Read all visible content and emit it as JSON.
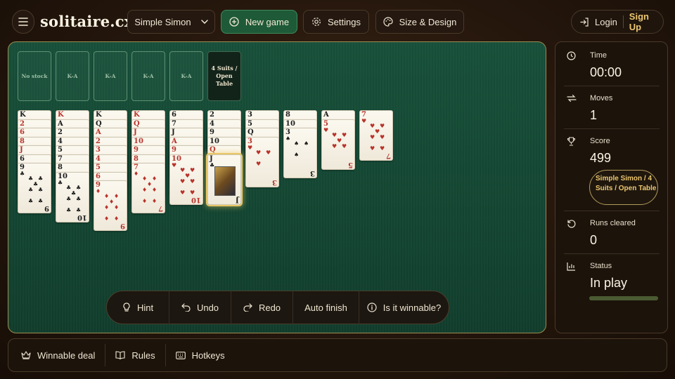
{
  "header": {
    "logo": "solitaire.cx",
    "game_select": "Simple Simon",
    "new_game": "New game",
    "settings": "Settings",
    "size_design": "Size & Design",
    "login": "Login",
    "signup": "Sign Up"
  },
  "board": {
    "stock_label": "No stock",
    "foundations": [
      "K-A",
      "K-A",
      "K-A",
      "K-A"
    ],
    "mode_badge_lines": [
      "4 Suits /",
      "Open",
      "Table"
    ]
  },
  "toolbar": {
    "hint": "Hint",
    "undo": "Undo",
    "redo": "Redo",
    "auto_finish": "Auto finish",
    "winnable": "Is it winnable?"
  },
  "sidebar": {
    "time_label": "Time",
    "time_value": "00:00",
    "moves_label": "Moves",
    "moves_value": "1",
    "score_label": "Score",
    "score_value": "499",
    "mode_badge": "Simple Simon / 4 Suits / Open Table",
    "runs_label": "Runs cleared",
    "runs_value": "0",
    "status_label": "Status",
    "status_value": "In play",
    "progress": 1.0
  },
  "footer": {
    "winnable_deal": "Winnable deal",
    "rules": "Rules",
    "hotkeys": "Hotkeys"
  },
  "colors": {
    "felt": "#134532",
    "accent": "#ecc670",
    "primary": "#1e5a37"
  },
  "tableau": [
    {
      "cards": [
        {
          "r": "K",
          "s": "♠",
          "c": "b"
        },
        {
          "r": "2",
          "s": "♥",
          "c": "r"
        },
        {
          "r": "6",
          "s": "♥",
          "c": "r"
        },
        {
          "r": "8",
          "s": "♥",
          "c": "r"
        },
        {
          "r": "J",
          "s": "♥",
          "c": "r"
        },
        {
          "r": "6",
          "s": "♠",
          "c": "b"
        },
        {
          "r": "9",
          "s": "♣",
          "c": "b"
        }
      ]
    },
    {
      "cards": [
        {
          "r": "K",
          "s": "♥",
          "c": "r"
        },
        {
          "r": "A",
          "s": "♠",
          "c": "b"
        },
        {
          "r": "2",
          "s": "♠",
          "c": "b"
        },
        {
          "r": "4",
          "s": "♠",
          "c": "b"
        },
        {
          "r": "5",
          "s": "♠",
          "c": "b"
        },
        {
          "r": "7",
          "s": "♠",
          "c": "b"
        },
        {
          "r": "8",
          "s": "♠",
          "c": "b"
        },
        {
          "r": "10",
          "s": "♣",
          "c": "b"
        }
      ]
    },
    {
      "cards": [
        {
          "r": "K",
          "s": "♠",
          "c": "b"
        },
        {
          "r": "Q",
          "s": "♠",
          "c": "b"
        },
        {
          "r": "A",
          "s": "♦",
          "c": "r"
        },
        {
          "r": "2",
          "s": "♦",
          "c": "r"
        },
        {
          "r": "3",
          "s": "♦",
          "c": "r"
        },
        {
          "r": "4",
          "s": "♦",
          "c": "r"
        },
        {
          "r": "5",
          "s": "♦",
          "c": "r"
        },
        {
          "r": "6",
          "s": "♦",
          "c": "r"
        },
        {
          "r": "9",
          "s": "♦",
          "c": "r"
        }
      ]
    },
    {
      "cards": [
        {
          "r": "K",
          "s": "♦",
          "c": "r"
        },
        {
          "r": "Q",
          "s": "♦",
          "c": "r"
        },
        {
          "r": "J",
          "s": "♦",
          "c": "r"
        },
        {
          "r": "10",
          "s": "♦",
          "c": "r"
        },
        {
          "r": "9",
          "s": "♦",
          "c": "r"
        },
        {
          "r": "8",
          "s": "♦",
          "c": "r"
        },
        {
          "r": "7",
          "s": "♦",
          "c": "r"
        }
      ]
    },
    {
      "cards": [
        {
          "r": "6",
          "s": "♣",
          "c": "b"
        },
        {
          "r": "7",
          "s": "♣",
          "c": "b"
        },
        {
          "r": "J",
          "s": "♣",
          "c": "b"
        },
        {
          "r": "A",
          "s": "♥",
          "c": "r"
        },
        {
          "r": "9",
          "s": "♥",
          "c": "r"
        },
        {
          "r": "10",
          "s": "♥",
          "c": "r"
        }
      ]
    },
    {
      "cards": [
        {
          "r": "2",
          "s": "♣",
          "c": "b"
        },
        {
          "r": "4",
          "s": "♣",
          "c": "b"
        },
        {
          "r": "9",
          "s": "♣",
          "c": "b"
        },
        {
          "r": "10",
          "s": "♣",
          "c": "b"
        },
        {
          "r": "Q",
          "s": "♥",
          "c": "r"
        },
        {
          "r": "J",
          "s": "♣",
          "c": "b",
          "sel": true
        }
      ]
    },
    {
      "cards": [
        {
          "r": "3",
          "s": "♠",
          "c": "b"
        },
        {
          "r": "5",
          "s": "♠",
          "c": "b"
        },
        {
          "r": "Q",
          "s": "♠",
          "c": "b"
        },
        {
          "r": "3",
          "s": "♥",
          "c": "r"
        }
      ]
    },
    {
      "cards": [
        {
          "r": "8",
          "s": "♠",
          "c": "b"
        },
        {
          "r": "10",
          "s": "♠",
          "c": "b"
        },
        {
          "r": "3",
          "s": "♠",
          "c": "b"
        }
      ]
    },
    {
      "cards": [
        {
          "r": "A",
          "s": "♣",
          "c": "b"
        },
        {
          "r": "5",
          "s": "♥",
          "c": "r"
        }
      ]
    },
    {
      "cards": [
        {
          "r": "7",
          "s": "♥",
          "c": "r"
        }
      ]
    }
  ]
}
